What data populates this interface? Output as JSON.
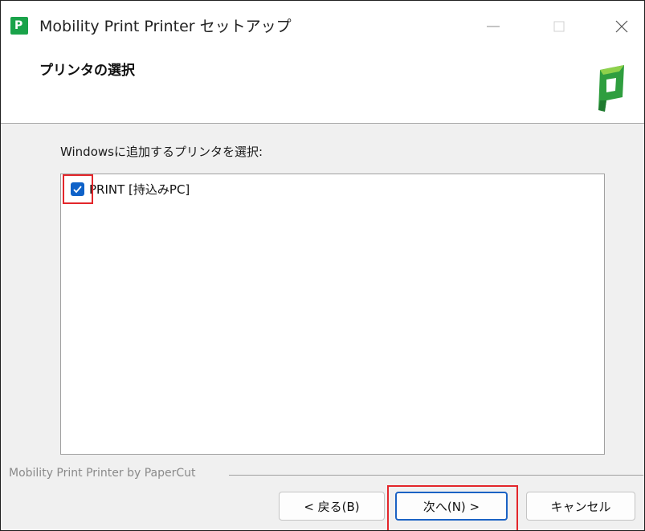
{
  "window": {
    "title": "Mobility Print Printer セットアップ",
    "controls": {
      "minimize_icon": "minimize-icon",
      "maximize_icon": "maximize-icon",
      "close_icon": "close-icon"
    }
  },
  "header": {
    "title": "プリンタの選択",
    "logo_icon": "papercut-logo-icon"
  },
  "main": {
    "prompt": "Windowsに追加するプリンタを選択:",
    "printers": [
      {
        "label": "PRINT [持込みPC]",
        "checked": true
      }
    ]
  },
  "footer": {
    "brand_text": "Mobility Print Printer by PaperCut",
    "buttons": {
      "back": "< 戻る(B)",
      "next": "次へ(N) >",
      "cancel": "キャンセル"
    }
  },
  "colors": {
    "accent": "#0f62c8",
    "highlight": "#e3262b",
    "brand_green": "#1aa34a",
    "content_bg": "#f0f0f0"
  }
}
